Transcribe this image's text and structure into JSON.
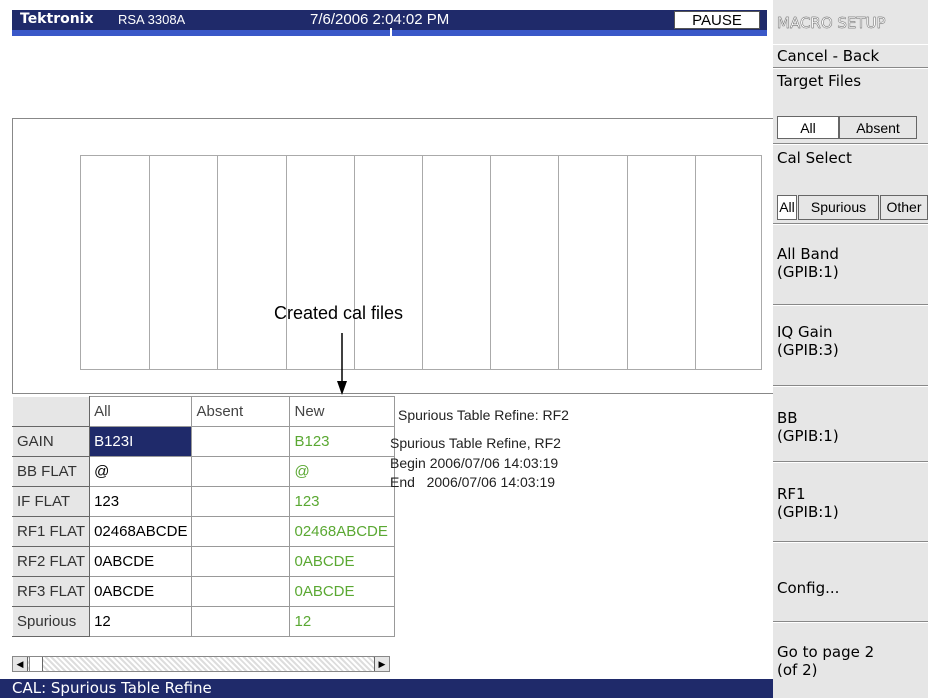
{
  "titlebar": {
    "brand": "Tektronix",
    "model": "RSA 3308A",
    "datetime": "7/6/2006 2:04:02 PM",
    "pause": "PAUSE"
  },
  "graph": {
    "annotation": "Created cal files"
  },
  "table": {
    "columns": [
      "All",
      "Absent",
      "New"
    ],
    "rows": [
      {
        "label": "GAIN",
        "all": "B123I",
        "absent": "",
        "new": "B123"
      },
      {
        "label": "BB FLAT",
        "all": "@",
        "absent": "",
        "new": "@"
      },
      {
        "label": "IF FLAT",
        "all": "123",
        "absent": "",
        "new": "123"
      },
      {
        "label": "RF1 FLAT",
        "all": "02468ABCDE",
        "absent": "",
        "new": "02468ABCDE"
      },
      {
        "label": "RF2 FLAT",
        "all": "0ABCDE",
        "absent": "",
        "new": "0ABCDE"
      },
      {
        "label": "RF3 FLAT",
        "all": "0ABCDE",
        "absent": "",
        "new": "0ABCDE"
      },
      {
        "label": "Spurious",
        "all": "12",
        "absent": "",
        "new": "12"
      }
    ]
  },
  "info": {
    "title": "Spurious Table Refine: RF2",
    "line1": "Spurious Table Refine, RF2",
    "line2": "Begin 2006/07/06 14:03:19",
    "line3": "End   2006/07/06 14:03:19"
  },
  "status": "CAL: Spurious Table Refine",
  "panel": {
    "title": "MACRO SETUP",
    "cancel": "Cancel - Back",
    "target_files": "Target Files",
    "target_all": "All",
    "target_absent": "Absent",
    "cal_select": "Cal Select",
    "cal_all": "All",
    "cal_spurious": "Spurious",
    "cal_other": "Other",
    "all_band_1": "All Band",
    "all_band_2": "(GPIB:1)",
    "iq_gain_1": "IQ Gain",
    "iq_gain_2": "(GPIB:3)",
    "bb_1": "BB",
    "bb_2": "(GPIB:1)",
    "rf1_1": "RF1",
    "rf1_2": "(GPIB:1)",
    "config": "Config...",
    "page_1": "Go to page 2",
    "page_2": "(of 2)"
  },
  "colors": {
    "titlebar": "#1f2a6a",
    "accent_stripe": "#3a58c8",
    "new_column_text": "#5aa832",
    "panel_bg": "#e6e6e6"
  },
  "icons": {
    "scroll_left": "triangle-left-icon",
    "scroll_right": "triangle-right-icon",
    "annotation_arrow": "arrow-down-icon"
  }
}
